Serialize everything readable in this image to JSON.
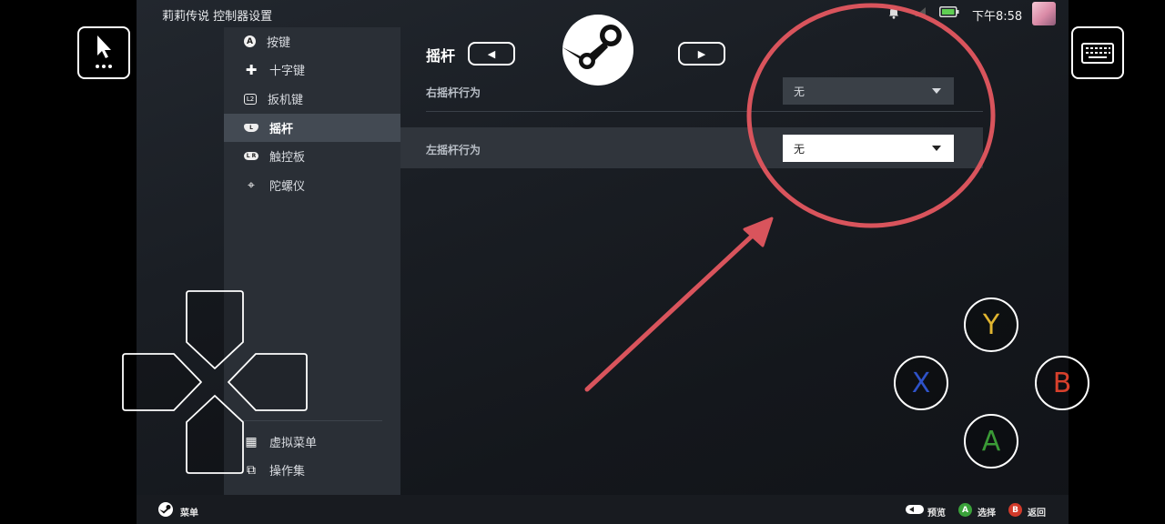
{
  "status_bar": {
    "app_title": "莉莉传说 控制器设置",
    "time": "下午8:58",
    "icons": [
      "bell-icon",
      "signal-icon",
      "battery-icon"
    ]
  },
  "nav": {
    "items": [
      {
        "label": "按键",
        "icon": "a-button-icon",
        "glyph": "A"
      },
      {
        "label": "十字键",
        "icon": "dpad-icon",
        "glyph": "✚"
      },
      {
        "label": "扳机键",
        "icon": "trigger-icon",
        "glyph": "L2"
      },
      {
        "label": "摇杆",
        "icon": "joystick-icon",
        "glyph": "L"
      },
      {
        "label": "触控板",
        "icon": "trackpad-icon",
        "glyph": "L R"
      },
      {
        "label": "陀螺仪",
        "icon": "gyro-icon",
        "glyph": "⌖"
      }
    ],
    "active_index": 3,
    "bottom_items": [
      {
        "label": "虚拟菜单",
        "icon": "grid-icon",
        "glyph": "▦"
      },
      {
        "label": "操作集",
        "icon": "action-set-icon",
        "glyph": "⧉"
      }
    ]
  },
  "content": {
    "section_title": "摇杆",
    "rows": [
      {
        "label": "右摇杆行为",
        "value": "无"
      },
      {
        "label": "左摇杆行为",
        "value": "无"
      }
    ]
  },
  "bottom_bar": {
    "menu_label": "菜单",
    "preview_label": "预览",
    "select_label": "选择",
    "back_label": "返回",
    "a_glyph": "A",
    "b_glyph": "B"
  },
  "overlay": {
    "face_buttons": {
      "y": "Y",
      "x": "X",
      "b": "B",
      "a": "A"
    },
    "colors": {
      "y": "#e0b530",
      "x": "#2e52c8",
      "b": "#d8402c",
      "a": "#3a9a36",
      "annotation": "#d9545c"
    }
  }
}
